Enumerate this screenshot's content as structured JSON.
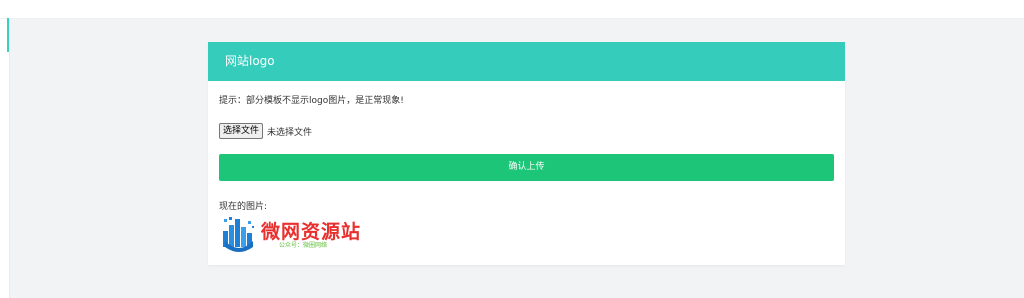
{
  "card": {
    "title": "网站logo",
    "tip": "提示：部分模板不显示logo图片，是正常现象!",
    "file_button_label": "选择文件",
    "file_status": "未选择文件",
    "upload_button_label": "确认上传",
    "current_image_label": "现在的图片:"
  },
  "logo": {
    "brand_text": "微网资源站",
    "subtext": "公众号：微圈网络"
  },
  "colors": {
    "header": "#36ccbc",
    "upload_button": "#1cc577",
    "logo_text": "#e8302f",
    "logo_icon": "#1e7fd6"
  }
}
